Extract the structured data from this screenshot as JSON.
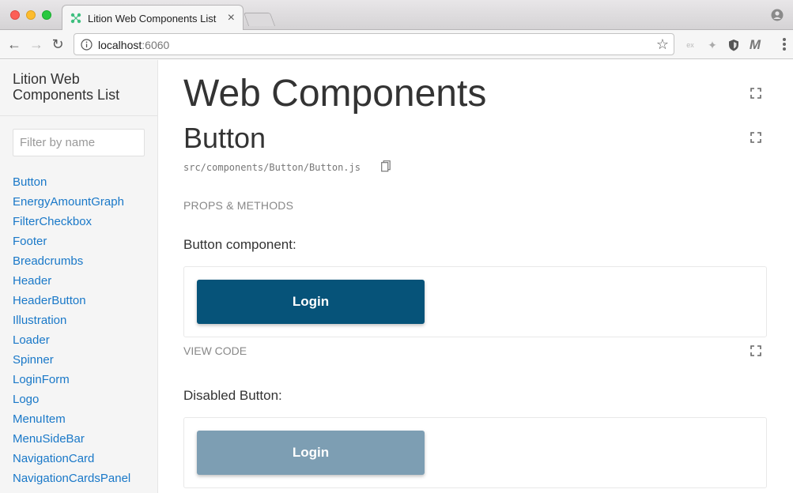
{
  "browser": {
    "tab_title": "Lition Web Components List",
    "url_host": "localhost",
    "url_port": ":6060",
    "extensions": [
      "ex",
      "puzzle-icon",
      "shield-icon",
      "M"
    ]
  },
  "sidebar": {
    "title": "Lition Web Components List",
    "filter_placeholder": "Filter by name",
    "items": [
      "Button",
      "EnergyAmountGraph",
      "FilterCheckbox",
      "Footer",
      "Breadcrumbs",
      "Header",
      "HeaderButton",
      "Illustration",
      "Loader",
      "Spinner",
      "LoginForm",
      "Logo",
      "MenuItem",
      "MenuSideBar",
      "NavigationCard",
      "NavigationCardsPanel"
    ]
  },
  "main": {
    "section_title": "Web Components",
    "component_title": "Button",
    "component_path": "src/components/Button/Button.js",
    "props_label": "PROPS & METHODS",
    "example1_label": "Button component:",
    "example1_button": "Login",
    "view_code_label": "VIEW CODE",
    "example2_label": "Disabled Button:",
    "example2_button": "Login"
  },
  "colors": {
    "link": "#1978c8",
    "primary_button": "#065379",
    "disabled_button": "#7d9eb3"
  }
}
